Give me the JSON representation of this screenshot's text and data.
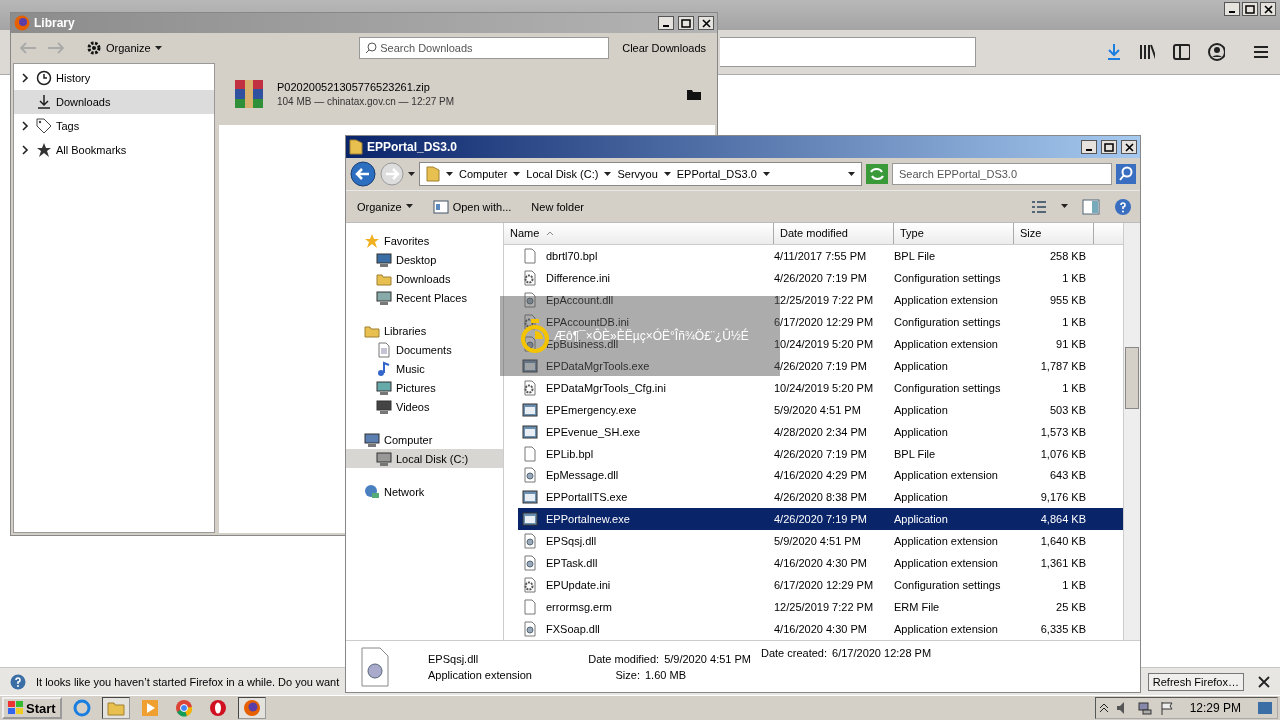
{
  "notification": {
    "text": "It looks like you haven’t started Firefox in a while. Do you want",
    "button": "Refresh Firefox…"
  },
  "library": {
    "title": "Library",
    "organize": "Organize",
    "search": {
      "placeholder": "Search Downloads"
    },
    "clear_button": "Clear Downloads",
    "sidebar": [
      {
        "label": "History",
        "kind": "history",
        "expandable": true,
        "selected": false
      },
      {
        "label": "Downloads",
        "kind": "downloads",
        "expandable": false,
        "selected": true
      },
      {
        "label": "Tags",
        "kind": "tags",
        "expandable": true,
        "selected": false
      },
      {
        "label": "All Bookmarks",
        "kind": "bookmarks",
        "expandable": true,
        "selected": false
      }
    ],
    "downloads": [
      {
        "name": "P020200521305776523261.zip",
        "details": "104 MB — chinatax.gov.cn — 12:27 PM"
      }
    ]
  },
  "explorer": {
    "title": "EPPortal_DS3.0",
    "breadcrumb": [
      "Computer",
      "Local Disk (C:)",
      "Servyou",
      "EPPortal_DS3.0"
    ],
    "search": {
      "placeholder": "Search EPPortal_DS3.0"
    },
    "toolbar": [
      {
        "label": "Organize",
        "kind": "menu"
      },
      {
        "label": "Open with...",
        "kind": "open"
      },
      {
        "label": "New folder",
        "kind": "plain"
      }
    ],
    "nav": [
      {
        "label": "Favorites",
        "kind": "favorites",
        "group": true,
        "selected": false
      },
      {
        "label": "Desktop",
        "kind": "desktop",
        "group": false,
        "selected": false
      },
      {
        "label": "Downloads",
        "kind": "folder",
        "group": false,
        "selected": false
      },
      {
        "label": "Recent Places",
        "kind": "recent",
        "group": false,
        "selected": false
      },
      {
        "label": "Libraries",
        "kind": "libraries",
        "group": true,
        "selected": false
      },
      {
        "label": "Documents",
        "kind": "doc",
        "group": false,
        "selected": false
      },
      {
        "label": "Music",
        "kind": "music",
        "group": false,
        "selected": false
      },
      {
        "label": "Pictures",
        "kind": "pictures",
        "group": false,
        "selected": false
      },
      {
        "label": "Videos",
        "kind": "videos",
        "group": false,
        "selected": false
      },
      {
        "label": "Computer",
        "kind": "computer",
        "group": true,
        "selected": false
      },
      {
        "label": "Local Disk (C:)",
        "kind": "disk",
        "group": false,
        "selected": true
      },
      {
        "label": "Network",
        "kind": "network",
        "group": true,
        "selected": false
      }
    ],
    "columns": [
      "Name",
      "Date modified",
      "Type",
      "Size"
    ],
    "rows": [
      {
        "name": "dbrtl70.bpl",
        "kind": "file",
        "date": "4/11/2017 7:55 PM",
        "type": "BPL File",
        "size": "258 KB",
        "selected": false
      },
      {
        "name": "Difference.ini",
        "kind": "config",
        "date": "4/26/2020 7:19 PM",
        "type": "Configuration settings",
        "size": "1 KB",
        "selected": false
      },
      {
        "name": "EpAccount.dll",
        "kind": "dll",
        "date": "12/25/2019 7:22 PM",
        "type": "Application extension",
        "size": "955 KB",
        "selected": false
      },
      {
        "name": "EPAccountDB.ini",
        "kind": "config",
        "date": "6/17/2020 12:29 PM",
        "type": "Configuration settings",
        "size": "1 KB",
        "selected": false
      },
      {
        "name": "EpBusiness.dll",
        "kind": "dll",
        "date": "10/24/2019 5:20 PM",
        "type": "Application extension",
        "size": "91 KB",
        "selected": false
      },
      {
        "name": "EPDataMgrTools.exe",
        "kind": "app",
        "date": "4/26/2020 7:19 PM",
        "type": "Application",
        "size": "1,787 KB",
        "selected": false
      },
      {
        "name": "EPDataMgrTools_Cfg.ini",
        "kind": "config",
        "date": "10/24/2019 5:20 PM",
        "type": "Configuration settings",
        "size": "1 KB",
        "selected": false
      },
      {
        "name": "EPEmergency.exe",
        "kind": "app",
        "date": "5/9/2020 4:51 PM",
        "type": "Application",
        "size": "503 KB",
        "selected": false
      },
      {
        "name": "EPEvenue_SH.exe",
        "kind": "app",
        "date": "4/28/2020 2:34 PM",
        "type": "Application",
        "size": "1,573 KB",
        "selected": false
      },
      {
        "name": "EPLib.bpl",
        "kind": "file",
        "date": "4/26/2020 7:19 PM",
        "type": "BPL File",
        "size": "1,076 KB",
        "selected": false
      },
      {
        "name": "EpMessage.dll",
        "kind": "dll",
        "date": "4/16/2020 4:29 PM",
        "type": "Application extension",
        "size": "643 KB",
        "selected": false
      },
      {
        "name": "EPPortalITS.exe",
        "kind": "app",
        "date": "4/26/2020 8:38 PM",
        "type": "Application",
        "size": "9,176 KB",
        "selected": false
      },
      {
        "name": "EPPortalnew.exe",
        "kind": "app",
        "date": "4/26/2020 7:19 PM",
        "type": "Application",
        "size": "4,864 KB",
        "selected": true
      },
      {
        "name": "EPSqsj.dll",
        "kind": "dll",
        "date": "5/9/2020 4:51 PM",
        "type": "Application extension",
        "size": "1,640 KB",
        "selected": false
      },
      {
        "name": "EPTask.dll",
        "kind": "dll",
        "date": "4/16/2020 4:30 PM",
        "type": "Application extension",
        "size": "1,361 KB",
        "selected": false
      },
      {
        "name": "EPUpdate.ini",
        "kind": "config",
        "date": "6/17/2020 12:29 PM",
        "type": "Configuration settings",
        "size": "1 KB",
        "selected": false
      },
      {
        "name": "errormsg.erm",
        "kind": "file",
        "date": "12/25/2019 7:22 PM",
        "type": "ERM File",
        "size": "25 KB",
        "selected": false
      },
      {
        "name": "FXSoap.dll",
        "kind": "dll",
        "date": "4/16/2020 4:30 PM",
        "type": "Application extension",
        "size": "6,335 KB",
        "selected": false
      }
    ],
    "details": {
      "name": "EPSqsj.dll",
      "type": "Application extension",
      "modified_label": "Date modified:",
      "modified": "5/9/2020 4:51 PM",
      "size_label": "Size:",
      "size": "1.60 MB",
      "created_label": "Date created:",
      "created": "6/17/2020 12:28 PM"
    }
  },
  "toast": {
    "text": "Æô¶¯×ÔÈ»ÈËµç×ÓË°Îñ¾Ö£¨¿Û½É"
  },
  "taskbar": {
    "start": "Start",
    "clock": "12:29 PM"
  }
}
